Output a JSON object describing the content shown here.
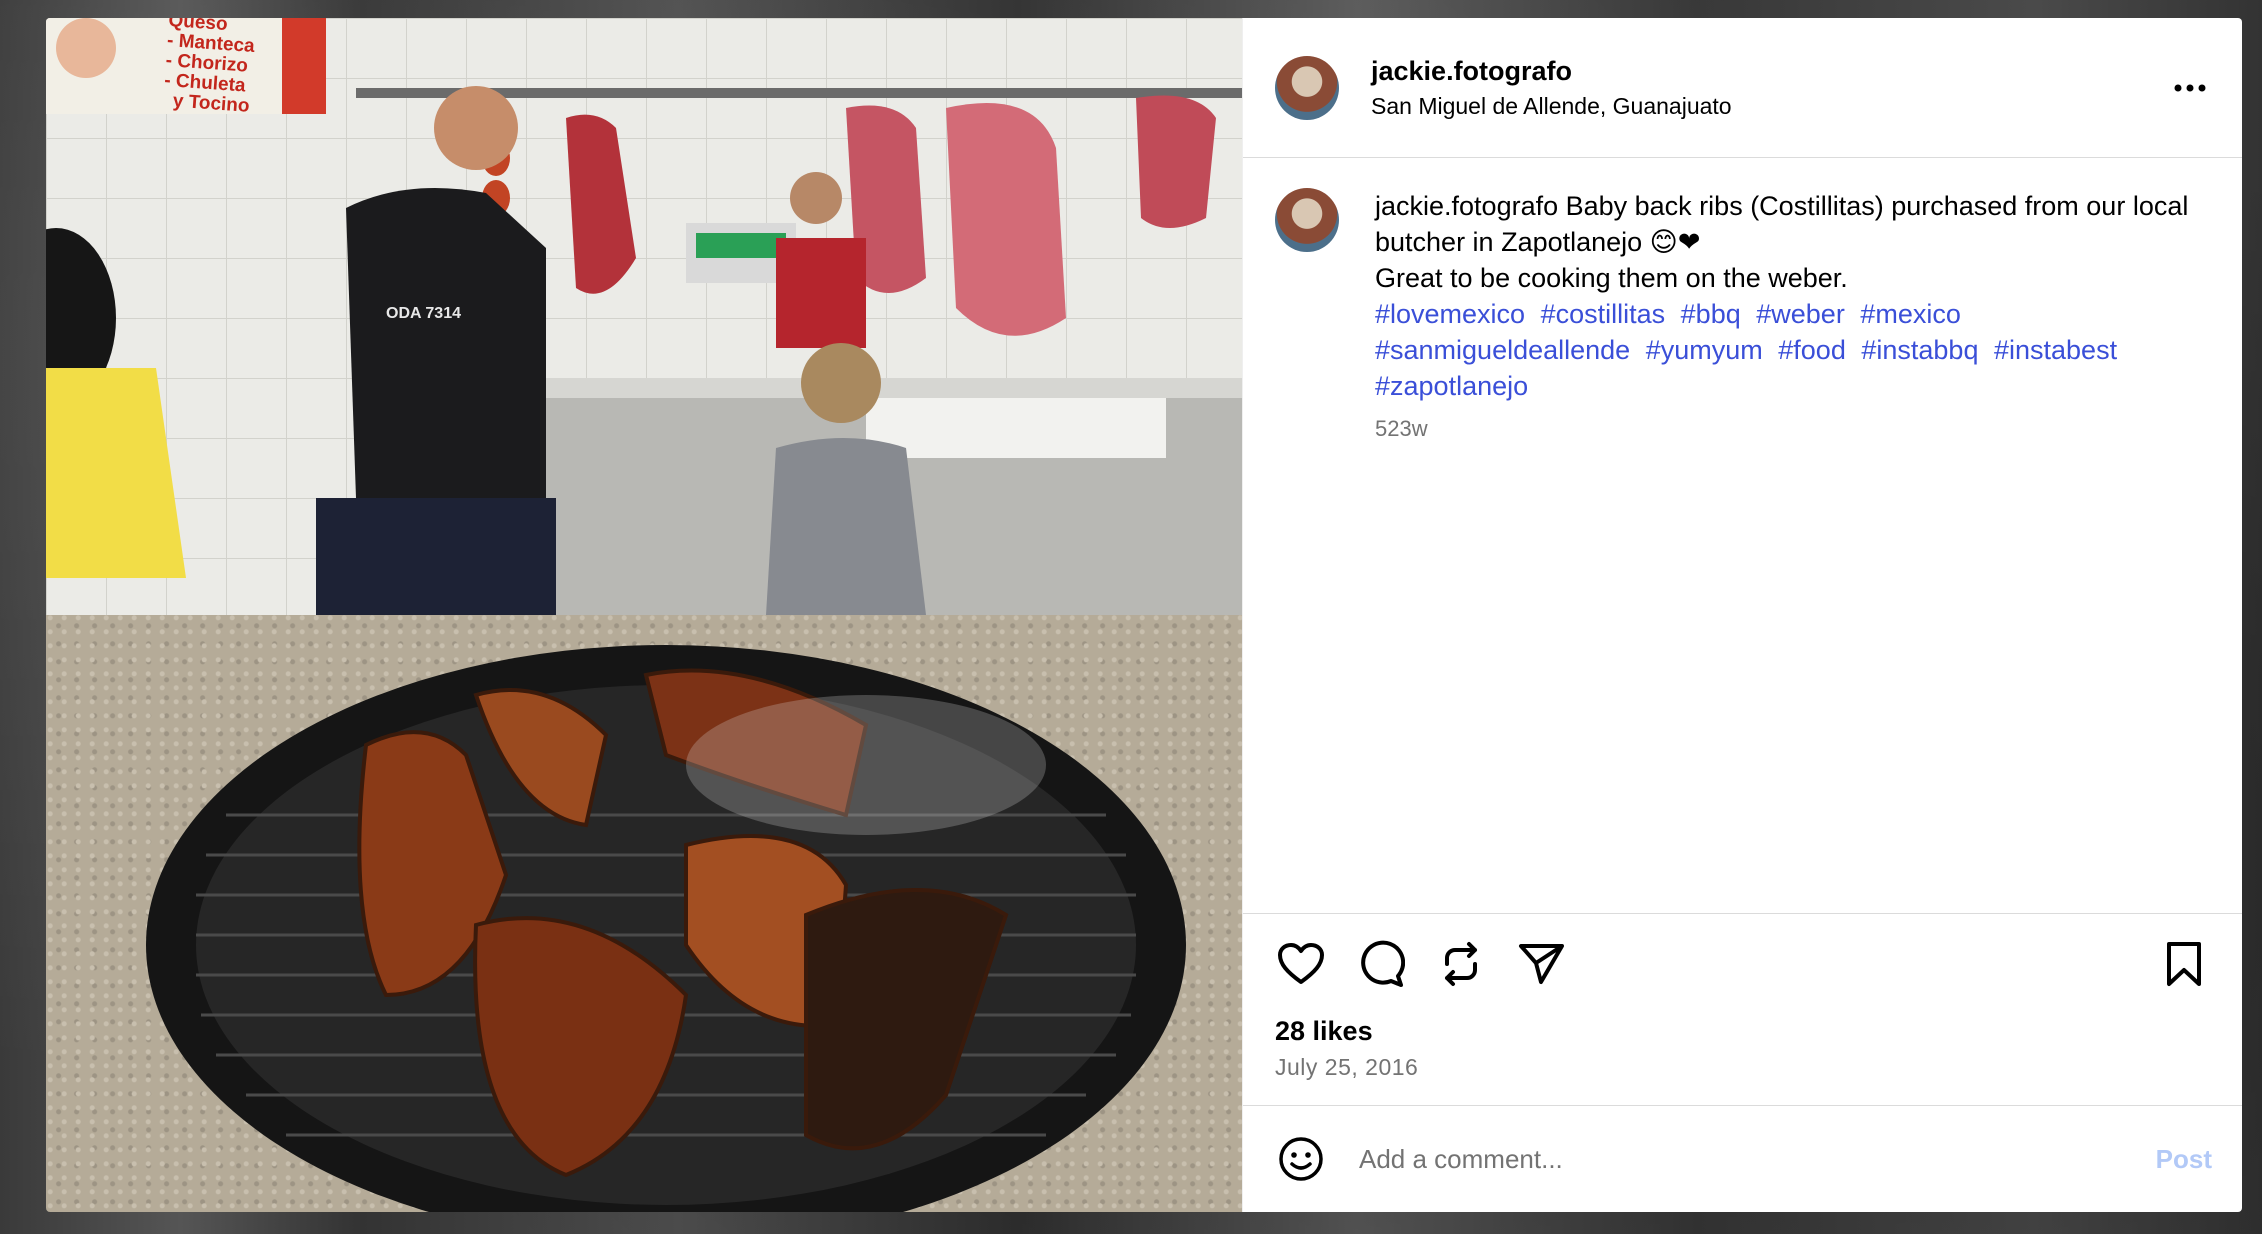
{
  "post": {
    "username": "jackie.fotografo",
    "location": "San Miguel de Allende, Guanajuato",
    "caption_line1": "jackie.fotografo Baby back ribs (Costillitas) purchased from our local butcher in Zapotlanejo 😊❤",
    "caption_line2": "Great to be cooking them on the weber.",
    "hashtags": [
      "#lovemexico",
      "#costillitas",
      "#bbq",
      "#weber",
      "#mexico",
      "#sanmigueldeallende",
      "#yumyum",
      "#food",
      "#instabbq",
      "#instabest",
      "#zapotlanejo"
    ],
    "age": "523w",
    "likes": "28 likes",
    "date": "July 25, 2016"
  },
  "comment": {
    "placeholder": "Add a comment...",
    "post_label": "Post"
  },
  "photo_sign": {
    "line1": "Queso",
    "line2": "- Manteca",
    "line3": "- Chorizo",
    "line4": "- Chuleta",
    "line5": "y Tocino",
    "shirt": "ODA 7314"
  },
  "icons": [
    "more-icon",
    "heart-icon",
    "comment-icon",
    "repost-icon",
    "share-icon",
    "bookmark-icon",
    "emoji-icon"
  ]
}
